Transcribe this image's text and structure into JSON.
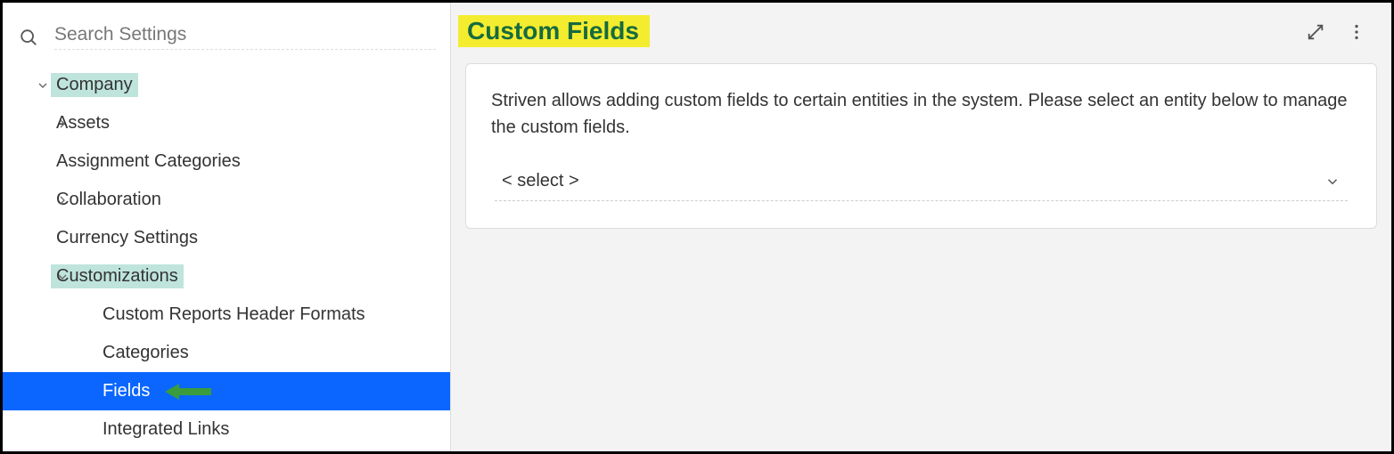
{
  "search": {
    "placeholder": "Search Settings"
  },
  "tree": [
    {
      "label": "Company",
      "depth": 0,
      "chevron": "down",
      "highlight": true,
      "name": "tree-item-company"
    },
    {
      "label": "Assets",
      "depth": 1,
      "chevron": "right",
      "name": "tree-item-assets"
    },
    {
      "label": "Assignment Categories",
      "depth": 1,
      "chevron": null,
      "name": "tree-item-assignment-categories"
    },
    {
      "label": "Collaboration",
      "depth": 1,
      "chevron": "right",
      "name": "tree-item-collaboration"
    },
    {
      "label": "Currency Settings",
      "depth": 1,
      "chevron": null,
      "name": "tree-item-currency-settings"
    },
    {
      "label": "Customizations",
      "depth": 1,
      "chevron": "down",
      "highlight": true,
      "name": "tree-item-customizations"
    },
    {
      "label": "Custom Reports Header Formats",
      "depth": 2,
      "chevron": null,
      "name": "tree-item-custom-reports-header-formats"
    },
    {
      "label": "Categories",
      "depth": 2,
      "chevron": null,
      "name": "tree-item-categories"
    },
    {
      "label": "Fields",
      "depth": 2,
      "chevron": null,
      "active": true,
      "arrow": true,
      "name": "tree-item-fields"
    },
    {
      "label": "Integrated Links",
      "depth": 2,
      "chevron": null,
      "name": "tree-item-integrated-links"
    }
  ],
  "main": {
    "title": "Custom Fields",
    "intro": "Striven allows adding custom fields to certain entities in the system. Please select an entity below to manage the custom fields.",
    "select_placeholder": "< select >"
  }
}
